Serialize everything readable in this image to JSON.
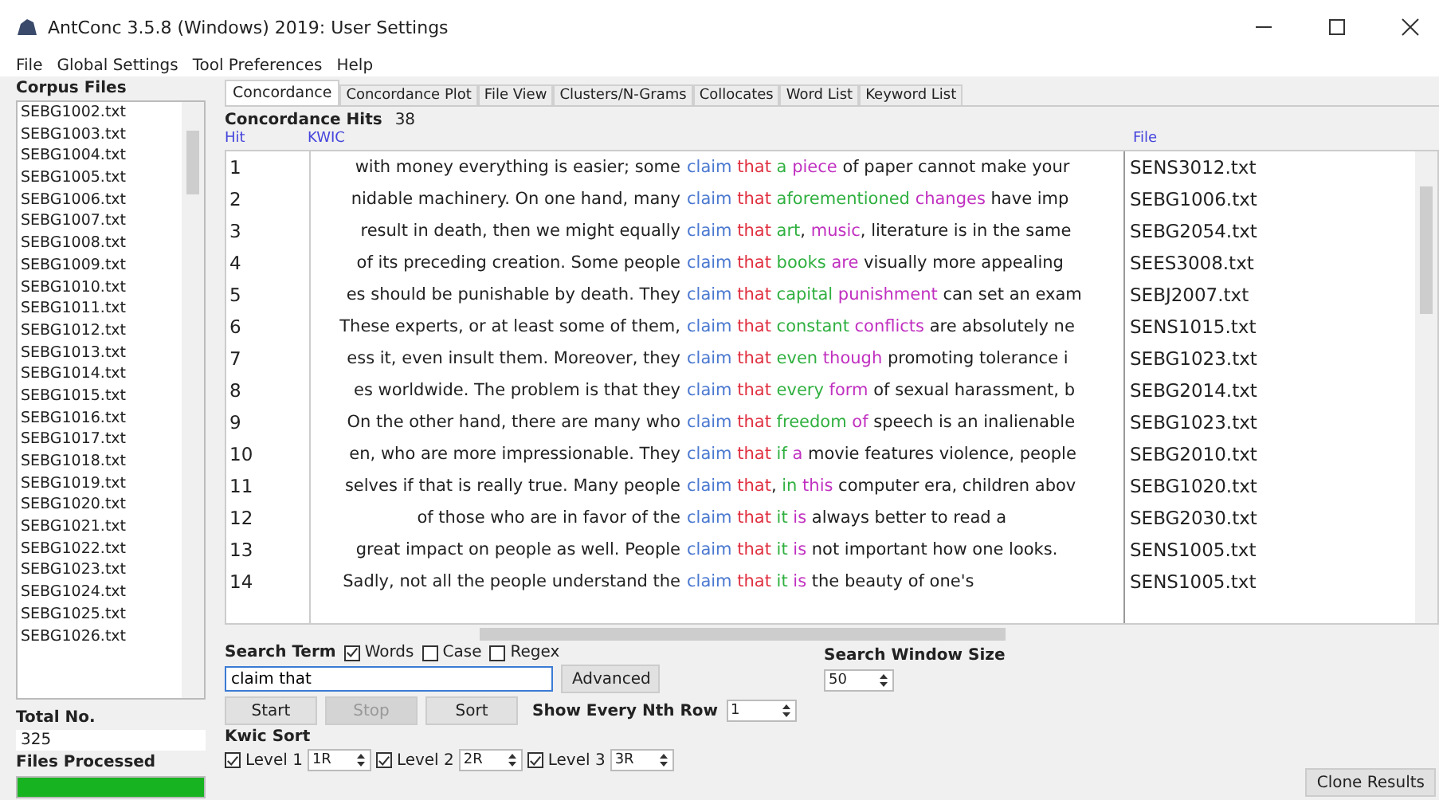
{
  "window": {
    "title": "AntConc 3.5.8 (Windows) 2019: User Settings"
  },
  "menu": [
    "File",
    "Global Settings",
    "Tool Preferences",
    "Help"
  ],
  "sidebar": {
    "title": "Corpus Files",
    "files": [
      "SEBG1002.txt",
      "SEBG1003.txt",
      "SEBG1004.txt",
      "SEBG1005.txt",
      "SEBG1006.txt",
      "SEBG1007.txt",
      "SEBG1008.txt",
      "SEBG1009.txt",
      "SEBG1010.txt",
      "SEBG1011.txt",
      "SEBG1012.txt",
      "SEBG1013.txt",
      "SEBG1014.txt",
      "SEBG1015.txt",
      "SEBG1016.txt",
      "SEBG1017.txt",
      "SEBG1018.txt",
      "SEBG1019.txt",
      "SEBG1020.txt",
      "SEBG1021.txt",
      "SEBG1022.txt",
      "SEBG1023.txt",
      "SEBG1024.txt",
      "SEBG1025.txt",
      "SEBG1026.txt"
    ],
    "total_label": "Total No.",
    "total": "325",
    "processed_label": "Files Processed",
    "progress": {
      "level": 1
    }
  },
  "tabs": [
    {
      "label": "Concordance",
      "selected": true
    },
    {
      "label": "Concordance Plot",
      "selected": false
    },
    {
      "label": "File View",
      "selected": false
    },
    {
      "label": "Clusters/N-Grams",
      "selected": false
    },
    {
      "label": "Collocates",
      "selected": false
    },
    {
      "label": "Word List",
      "selected": false
    },
    {
      "label": "Keyword List",
      "selected": false
    }
  ],
  "hits": {
    "label": "Concordance Hits",
    "count": "38"
  },
  "table": {
    "columns": [
      "Hit",
      "KWIC",
      "File"
    ],
    "rows": [
      {
        "hit": "1",
        "left": "with money everything is easier; some",
        "kwic": [
          {
            "text": "claim",
            "color": "#4a78d0"
          },
          {
            "text": " that",
            "color": "#e03040"
          },
          {
            "text": " a",
            "color": "#30b040"
          },
          {
            "text": " piece",
            "color": "#c030c0"
          },
          {
            "text": " of paper cannot make your",
            "color": "#202020"
          }
        ],
        "file": "SENS3012.txt"
      },
      {
        "hit": "2",
        "left": "nidable machinery. On one hand, many",
        "kwic": [
          {
            "text": "claim",
            "color": "#4a78d0"
          },
          {
            "text": " that",
            "color": "#e03040"
          },
          {
            "text": " aforementioned",
            "color": "#30b040"
          },
          {
            "text": " changes",
            "color": "#c030c0"
          },
          {
            "text": " have imp",
            "color": "#202020"
          }
        ],
        "file": "SEBG1006.txt"
      },
      {
        "hit": "3",
        "left": "result in death, then we might equally",
        "kwic": [
          {
            "text": "claim",
            "color": "#4a78d0"
          },
          {
            "text": " that",
            "color": "#e03040"
          },
          {
            "text": " art",
            "color": "#30b040"
          },
          {
            "text": ",",
            "color": "#202020"
          },
          {
            "text": " music",
            "color": "#c030c0"
          },
          {
            "text": ", literature is in the same",
            "color": "#202020"
          }
        ],
        "file": "SEBG2054.txt"
      },
      {
        "hit": "4",
        "left": "of its preceding creation. Some people",
        "kwic": [
          {
            "text": "claim",
            "color": "#4a78d0"
          },
          {
            "text": " that",
            "color": "#e03040"
          },
          {
            "text": " books",
            "color": "#30b040"
          },
          {
            "text": " are",
            "color": "#c030c0"
          },
          {
            "text": " visually more appealing",
            "color": "#202020"
          }
        ],
        "file": "SEES3008.txt"
      },
      {
        "hit": "5",
        "left": "es should be punishable by death. They",
        "kwic": [
          {
            "text": "claim",
            "color": "#4a78d0"
          },
          {
            "text": " that",
            "color": "#e03040"
          },
          {
            "text": " capital",
            "color": "#30b040"
          },
          {
            "text": " punishment",
            "color": "#c030c0"
          },
          {
            "text": " can set an exam",
            "color": "#202020"
          }
        ],
        "file": "SEBJ2007.txt"
      },
      {
        "hit": "6",
        "left": "These experts, or at least some of them,",
        "kwic": [
          {
            "text": "claim",
            "color": "#4a78d0"
          },
          {
            "text": " that",
            "color": "#e03040"
          },
          {
            "text": " constant",
            "color": "#30b040"
          },
          {
            "text": " conflicts",
            "color": "#c030c0"
          },
          {
            "text": " are absolutely ne",
            "color": "#202020"
          }
        ],
        "file": "SENS1015.txt"
      },
      {
        "hit": "7",
        "left": "ess it, even insult them. Moreover, they",
        "kwic": [
          {
            "text": "claim",
            "color": "#4a78d0"
          },
          {
            "text": " that",
            "color": "#e03040"
          },
          {
            "text": " even",
            "color": "#30b040"
          },
          {
            "text": " though",
            "color": "#c030c0"
          },
          {
            "text": " promoting tolerance i",
            "color": "#202020"
          }
        ],
        "file": "SEBG1023.txt"
      },
      {
        "hit": "8",
        "left": "es worldwide. The problem is that they",
        "kwic": [
          {
            "text": "claim",
            "color": "#4a78d0"
          },
          {
            "text": " that",
            "color": "#e03040"
          },
          {
            "text": " every",
            "color": "#30b040"
          },
          {
            "text": " form",
            "color": "#c030c0"
          },
          {
            "text": " of sexual harassment, b",
            "color": "#202020"
          }
        ],
        "file": "SEBG2014.txt"
      },
      {
        "hit": "9",
        "left": "On the other hand, there are many who",
        "kwic": [
          {
            "text": "claim",
            "color": "#4a78d0"
          },
          {
            "text": " that",
            "color": "#e03040"
          },
          {
            "text": " freedom",
            "color": "#30b040"
          },
          {
            "text": " of",
            "color": "#c030c0"
          },
          {
            "text": " speech is an inalienable",
            "color": "#202020"
          }
        ],
        "file": "SEBG1023.txt"
      },
      {
        "hit": "10",
        "left": "en, who are more impressionable. They",
        "kwic": [
          {
            "text": "claim",
            "color": "#4a78d0"
          },
          {
            "text": " that",
            "color": "#e03040"
          },
          {
            "text": " if",
            "color": "#30b040"
          },
          {
            "text": " a",
            "color": "#c030c0"
          },
          {
            "text": " movie features violence, people",
            "color": "#202020"
          }
        ],
        "file": "SEBG2010.txt"
      },
      {
        "hit": "11",
        "left": "selves if that is really true. Many people",
        "kwic": [
          {
            "text": "claim",
            "color": "#4a78d0"
          },
          {
            "text": " that",
            "color": "#e03040"
          },
          {
            "text": ",",
            "color": "#202020"
          },
          {
            "text": " in",
            "color": "#30b040"
          },
          {
            "text": " this",
            "color": "#c030c0"
          },
          {
            "text": " computer era, children abov",
            "color": "#202020"
          }
        ],
        "file": "SEBG1020.txt"
      },
      {
        "hit": "12",
        "left": "of those who are in favor of the",
        "kwic": [
          {
            "text": "claim",
            "color": "#4a78d0"
          },
          {
            "text": " that",
            "color": "#e03040"
          },
          {
            "text": " it",
            "color": "#30b040"
          },
          {
            "text": " is",
            "color": "#c030c0"
          },
          {
            "text": " always better to read a",
            "color": "#202020"
          }
        ],
        "file": "SEBG2030.txt"
      },
      {
        "hit": "13",
        "left": "great impact on people as well. People",
        "kwic": [
          {
            "text": "claim",
            "color": "#4a78d0"
          },
          {
            "text": " that",
            "color": "#e03040"
          },
          {
            "text": " it",
            "color": "#30b040"
          },
          {
            "text": " is",
            "color": "#c030c0"
          },
          {
            "text": " not important how one looks.",
            "color": "#202020"
          }
        ],
        "file": "SENS1005.txt"
      },
      {
        "hit": "14",
        "left": "Sadly, not all the people understand the",
        "kwic": [
          {
            "text": "claim",
            "color": "#4a78d0"
          },
          {
            "text": " that",
            "color": "#e03040"
          },
          {
            "text": " it",
            "color": "#30b040"
          },
          {
            "text": " is",
            "color": "#c030c0"
          },
          {
            "text": " the beauty of one's",
            "color": "#202020"
          }
        ],
        "file": "SENS1005.txt"
      }
    ]
  },
  "search": {
    "label": "Search Term",
    "options": [
      {
        "label": "Words",
        "checked": true
      },
      {
        "label": "Case",
        "checked": false
      },
      {
        "label": "Regex",
        "checked": false
      }
    ],
    "value": "claim that",
    "advanced": "Advanced"
  },
  "buttons": [
    {
      "label": "Start",
      "disabled": false
    },
    {
      "label": "Stop",
      "disabled": true
    },
    {
      "label": "Sort",
      "disabled": false
    }
  ],
  "nth_row": {
    "label": "Show Every Nth Row",
    "value": "1"
  },
  "window_size": {
    "label": "Search Window Size",
    "value": "50"
  },
  "kwic_sort": {
    "label": "Kwic Sort",
    "levels": [
      {
        "label": "Level 1",
        "checked": true,
        "value": "1R"
      },
      {
        "label": "Level 2",
        "checked": true,
        "value": "2R"
      },
      {
        "label": "Level 3",
        "checked": true,
        "value": "3R"
      }
    ]
  },
  "clone": "Clone Results"
}
